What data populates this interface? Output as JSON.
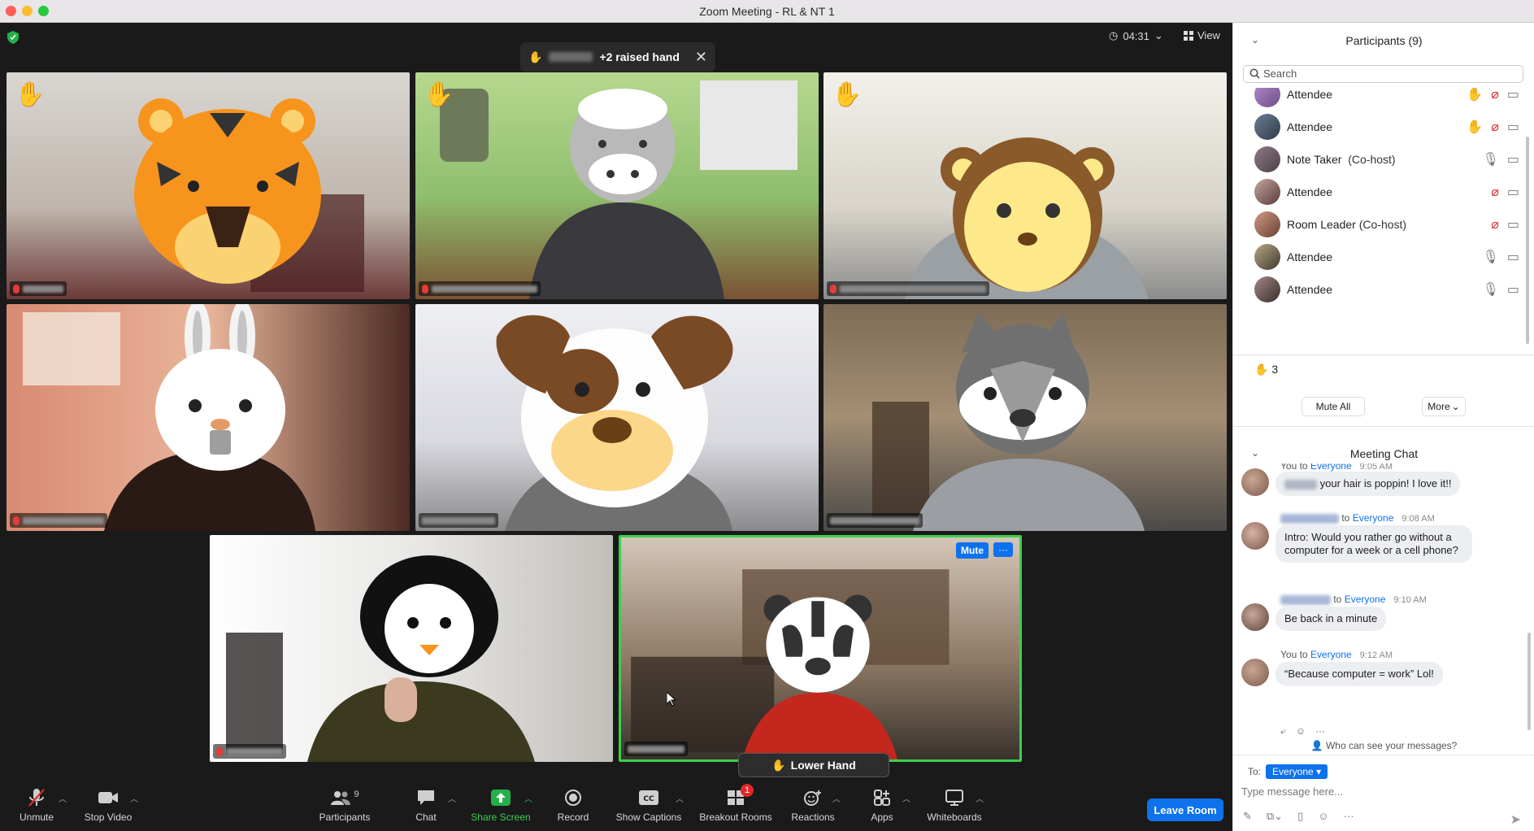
{
  "window": {
    "title": "Zoom Meeting - RL & NT 1"
  },
  "meeting": {
    "raised_hand_banner": "+2 raised hand",
    "banner_close": "✕",
    "timer": "04:31",
    "view_label": "View",
    "lower_hand_label": "Lower Hand",
    "tile_mute_label": "Mute",
    "tile_more_label": "···"
  },
  "tiles": [
    {
      "avatar": "tiger",
      "hand_raised": true,
      "muted": true,
      "active": false
    },
    {
      "avatar": "cow",
      "hand_raised": true,
      "muted": true,
      "active": false
    },
    {
      "avatar": "monkey",
      "hand_raised": true,
      "muted": true,
      "active": false
    },
    {
      "avatar": "bunny",
      "hand_raised": false,
      "muted": true,
      "active": false
    },
    {
      "avatar": "dog",
      "hand_raised": false,
      "muted": false,
      "active": false
    },
    {
      "avatar": "wolf",
      "hand_raised": false,
      "muted": false,
      "active": false
    },
    {
      "avatar": "penguin",
      "hand_raised": false,
      "muted": true,
      "active": false
    },
    {
      "avatar": "badger",
      "hand_raised": false,
      "muted": false,
      "active": true
    }
  ],
  "toolbar": {
    "unmute": "Unmute",
    "stop_video": "Stop Video",
    "participants": "Participants",
    "participants_count": "9",
    "chat": "Chat",
    "share_screen": "Share Screen",
    "record": "Record",
    "show_captions": "Show Captions",
    "breakout_rooms": "Breakout Rooms",
    "breakout_badge": "1",
    "reactions": "Reactions",
    "apps": "Apps",
    "whiteboards": "Whiteboards",
    "leave": "Leave Room"
  },
  "participants_panel": {
    "title": "Participants (9)",
    "search_placeholder": "Search",
    "participants": [
      {
        "name": "Attendee",
        "role": "",
        "hand": true,
        "mic": "muted",
        "video": "on"
      },
      {
        "name": "Attendee",
        "role": "",
        "hand": true,
        "mic": "muted",
        "video": "on"
      },
      {
        "name": "Note Taker",
        "role": "(Co-host)",
        "hand": false,
        "mic": "on",
        "video": "on"
      },
      {
        "name": "Attendee",
        "role": "",
        "hand": false,
        "mic": "muted",
        "video": "on"
      },
      {
        "name": "Room Leader",
        "role": "(Co-host)",
        "hand": false,
        "mic": "muted",
        "video": "on"
      },
      {
        "name": "Attendee",
        "role": "",
        "hand": false,
        "mic": "on",
        "video": "on"
      },
      {
        "name": "Attendee",
        "role": "",
        "hand": false,
        "mic": "on",
        "video": "on"
      }
    ],
    "raised_hand_count": "3",
    "mute_all": "Mute All",
    "more": "More"
  },
  "chat": {
    "title": "Meeting Chat",
    "messages": [
      {
        "from": "You",
        "to": "Everyone",
        "time": "9:05 AM",
        "text": "your hair is poppin! I love it!!"
      },
      {
        "from": "",
        "to": "Everyone",
        "time": "9:08 AM",
        "text": "Intro: Would you rather go without a computer for a week or a cell phone?"
      },
      {
        "from": "",
        "to": "Everyone",
        "time": "9:10 AM",
        "text": "Be back in a minute"
      },
      {
        "from": "You",
        "to": "Everyone",
        "time": "9:12 AM",
        "text": "“Because computer = work” Lol!"
      }
    ],
    "to_word": "to",
    "who_can_see": "Who can see your messages?",
    "to_label": "To:",
    "recipient": "Everyone",
    "compose_placeholder": "Type message here..."
  }
}
